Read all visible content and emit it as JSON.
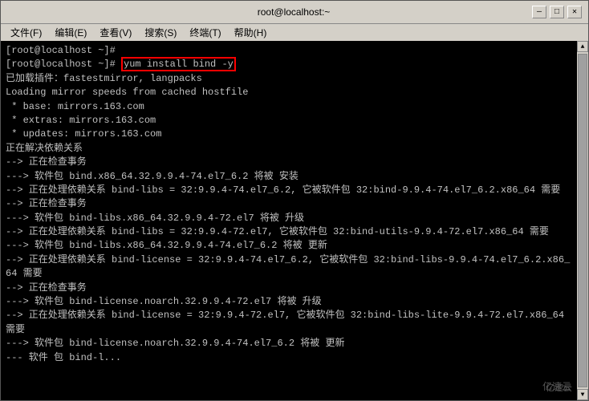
{
  "window": {
    "title": "root@localhost:~",
    "menu": {
      "items": [
        "文件(F)",
        "编辑(E)",
        "查看(V)",
        "搜索(S)",
        "终端(T)",
        "帮助(H)"
      ]
    }
  },
  "terminal": {
    "lines": [
      "[root@localhost ~]# ",
      "[root@localhost ~]# yum install bind -y",
      "已加载插件：fastestmirror, langpacks",
      "Loading mirror speeds from cached hostfile",
      " * base: mirrors.163.com",
      " * extras: mirrors.163.com",
      " * updates: mirrors.163.com",
      "正在解决依赖关系",
      "--> 正在检查事务",
      "---> 软件包 bind.x86_64.32.9.9.4-74.el7_6.2 将被 安装",
      "--> 正在处理依赖关系 bind-libs = 32:9.9.4-74.el7_6.2, 它被软件包 32:bind-9.9.4-74.el7_6.2.x86_64 需要",
      "--> 正在检查事务",
      "---> 软件包 bind-libs.x86_64.32.9.9.4-72.el7 将被 升级",
      "--> 正在处理依赖关系 bind-libs = 32:9.9.4-72.el7, 它被软件包 32:bind-utils-9.9.4-72.el7.x86_64 需要",
      "---> 软件包 bind-libs.x86_64.32.9.9.4-74.el7_6.2 将被 更新",
      "--> 正在处理依赖关系 bind-license = 32:9.9.4-74.el7_6.2, 它被软件包 32:bind-libs-9.9.4-74.el7_6.2.x86_64 需要",
      "--> 正在检查事务",
      "---> 软件包 bind-license.noarch.32.9.9.4-72.el7 将被 升级",
      "--> 正在处理依赖关系 bind-license = 32:9.9.4-72.el7, 它被软件包 32:bind-libs-lite-9.9.4-72.el7.x86_64 需要",
      "---> 软件包 bind-license.noarch.32.9.9.4-74.el7_6.2 将被 更新",
      "--- 软件 包 bind-l..."
    ],
    "highlighted_command": "yum install bind -y",
    "watermark": "亿速云"
  }
}
